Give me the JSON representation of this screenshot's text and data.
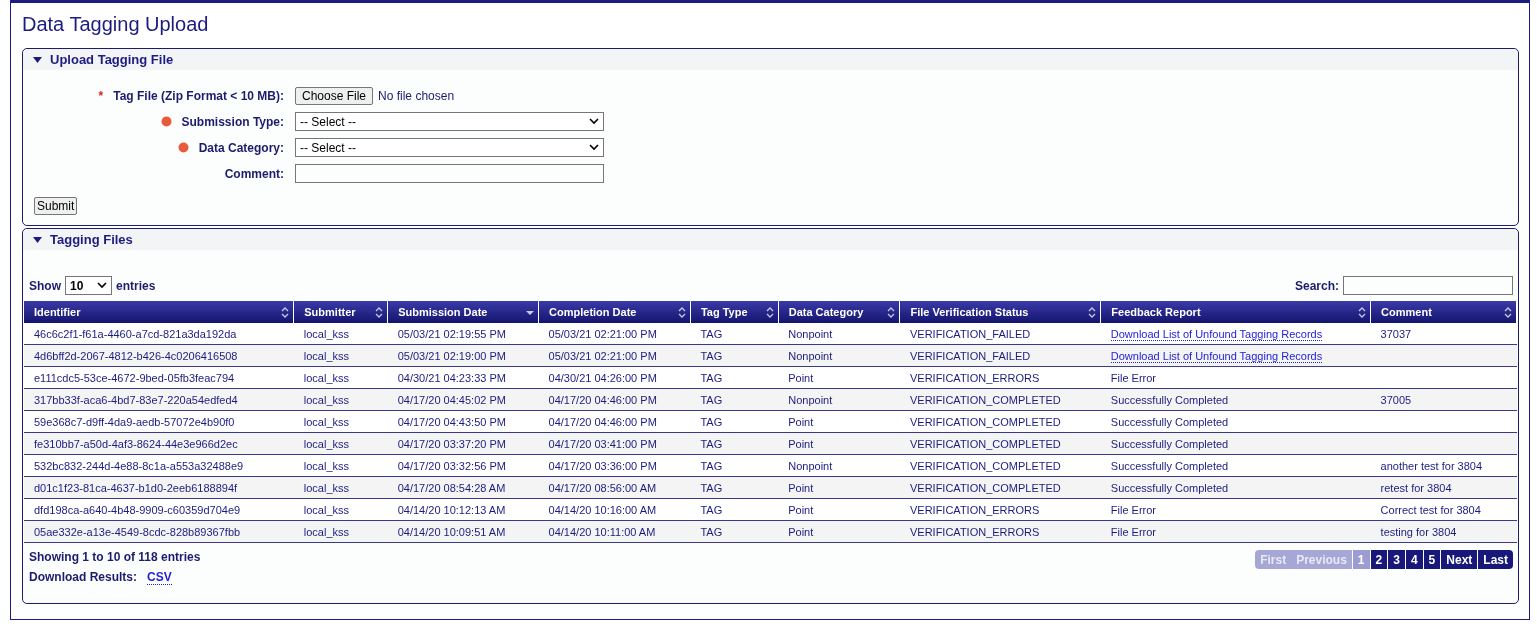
{
  "page_title": "Data Tagging Upload",
  "upload_panel": {
    "title": "Upload Tagging File",
    "expanded": true,
    "fields": [
      {
        "kind": "file",
        "label": "Tag File (Zip Format < 10 MB):",
        "required_mark": "*",
        "button": "Choose File",
        "status": "No file chosen"
      },
      {
        "kind": "select",
        "label": "Submission Type:",
        "required": true,
        "value": "-- Select --"
      },
      {
        "kind": "select",
        "label": "Data Category:",
        "required": true,
        "value": "-- Select --"
      },
      {
        "kind": "text",
        "label": "Comment:",
        "required": false
      }
    ],
    "submit": "Submit"
  },
  "files_panel": {
    "title": "Tagging Files",
    "expanded": true,
    "show_label": "Show",
    "page_size": "10",
    "entries_label": "entries",
    "search_label": "Search:",
    "columns": [
      {
        "label": "Identifier",
        "sorted": false
      },
      {
        "label": "Submitter",
        "sorted": false
      },
      {
        "label": "Submission Date",
        "sorted": true
      },
      {
        "label": "Completion Date",
        "sorted": false
      },
      {
        "label": "Tag Type",
        "sorted": false
      },
      {
        "label": "Data Category",
        "sorted": false
      },
      {
        "label": "File Verification Status",
        "sorted": false
      },
      {
        "label": "Feedback Report",
        "sorted": false
      },
      {
        "label": "Comment",
        "sorted": false
      }
    ],
    "rows": [
      {
        "cells": [
          "46c6c2f1-f61a-4460-a7cd-821a3da192da",
          "local_kss",
          "05/03/21 02:19:55 PM",
          "05/03/21 02:21:00 PM",
          "TAG",
          "Nonpoint",
          "VERIFICATION_FAILED",
          "Download List of Unfound Tagging Records",
          "37037"
        ],
        "feedback_link": true
      },
      {
        "cells": [
          "4d6bff2d-2067-4812-b426-4c0206416508",
          "local_kss",
          "05/03/21 02:19:00 PM",
          "05/03/21 02:21:00 PM",
          "TAG",
          "Nonpoint",
          "VERIFICATION_FAILED",
          "Download List of Unfound Tagging Records",
          ""
        ],
        "feedback_link": true
      },
      {
        "cells": [
          "e111cdc5-53ce-4672-9bed-05fb3feac794",
          "local_kss",
          "04/30/21 04:23:33 PM",
          "04/30/21 04:26:00 PM",
          "TAG",
          "Point",
          "VERIFICATION_ERRORS",
          "File Error",
          ""
        ],
        "feedback_link": false
      },
      {
        "cells": [
          "317bb33f-aca6-4bd7-83e7-220a54edfed4",
          "local_kss",
          "04/17/20 04:45:02 PM",
          "04/17/20 04:46:00 PM",
          "TAG",
          "Nonpoint",
          "VERIFICATION_COMPLETED",
          "Successfully Completed",
          "37005"
        ],
        "feedback_link": false
      },
      {
        "cells": [
          "59e368c7-d9ff-4da9-aedb-57072e4b90f0",
          "local_kss",
          "04/17/20 04:43:50 PM",
          "04/17/20 04:46:00 PM",
          "TAG",
          "Point",
          "VERIFICATION_COMPLETED",
          "Successfully Completed",
          ""
        ],
        "feedback_link": false
      },
      {
        "cells": [
          "fe310bb7-a50d-4af3-8624-44e3e966d2ec",
          "local_kss",
          "04/17/20 03:37:20 PM",
          "04/17/20 03:41:00 PM",
          "TAG",
          "Point",
          "VERIFICATION_COMPLETED",
          "Successfully Completed",
          ""
        ],
        "feedback_link": false
      },
      {
        "cells": [
          "532bc832-244d-4e88-8c1a-a553a32488e9",
          "local_kss",
          "04/17/20 03:32:56 PM",
          "04/17/20 03:36:00 PM",
          "TAG",
          "Nonpoint",
          "VERIFICATION_COMPLETED",
          "Successfully Completed",
          "another test for 3804"
        ],
        "feedback_link": false
      },
      {
        "cells": [
          "d01c1f23-81ca-4637-b1d0-2eeb6188894f",
          "local_kss",
          "04/17/20 08:54:28 AM",
          "04/17/20 08:56:00 AM",
          "TAG",
          "Point",
          "VERIFICATION_COMPLETED",
          "Successfully Completed",
          "retest for 3804"
        ],
        "feedback_link": false
      },
      {
        "cells": [
          "dfd198ca-a640-4b48-9909-c60359d704e9",
          "local_kss",
          "04/14/20 10:12:13 AM",
          "04/14/20 10:16:00 AM",
          "TAG",
          "Point",
          "VERIFICATION_ERRORS",
          "File Error",
          "Correct test for 3804"
        ],
        "feedback_link": false
      },
      {
        "cells": [
          "05ae332e-a13e-4549-8cdc-828b89367fbb",
          "local_kss",
          "04/14/20 10:09:51 AM",
          "04/14/20 10:11:00 AM",
          "TAG",
          "Point",
          "VERIFICATION_ERRORS",
          "File Error",
          "testing for 3804"
        ],
        "feedback_link": false
      }
    ],
    "info": "Showing 1 to 10 of 118 entries",
    "download_label": "Download Results:",
    "download_link": "CSV",
    "pagination": [
      {
        "label": "First",
        "disabled": true,
        "selected": false
      },
      {
        "label": "Previous",
        "disabled": true,
        "selected": false
      },
      {
        "label": "1",
        "disabled": false,
        "selected": true
      },
      {
        "label": "2",
        "disabled": false,
        "selected": false
      },
      {
        "label": "3",
        "disabled": false,
        "selected": false
      },
      {
        "label": "4",
        "disabled": false,
        "selected": false
      },
      {
        "label": "5",
        "disabled": false,
        "selected": false
      },
      {
        "label": "Next",
        "disabled": false,
        "selected": false
      },
      {
        "label": "Last",
        "disabled": false,
        "selected": false
      }
    ]
  }
}
